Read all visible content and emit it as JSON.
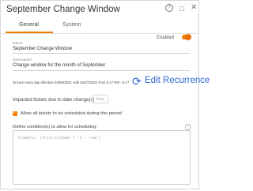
{
  "window": {
    "title": "September Change Window"
  },
  "icons": {
    "help": "question-circle-icon",
    "restore": "restore-icon",
    "close": "close-icon",
    "edit": "sync-icon"
  },
  "tabs": [
    {
      "label": "General",
      "active": true
    },
    {
      "label": "System",
      "active": false
    }
  ],
  "enabled": {
    "label": "Enabled",
    "value": true
  },
  "fields": {
    "name": {
      "label": "Name",
      "value": "September Change Window"
    },
    "description": {
      "label": "Description",
      "value": "Change window for the month of September"
    }
  },
  "recurrence": {
    "summary": "Occurs every day effective 04/09/2021 until 04/27/2021 from 5:17 PM - 6:17 PM",
    "edit_label": "Edit Recurrence"
  },
  "impacted": {
    "label": "Impacted tickets due to date change(s)",
    "view_label": "View"
  },
  "allow_all": {
    "label": "Allow all tickets to be scheduled during this period",
    "checked": true
  },
  "conditions": {
    "label": "Define condition(s) to allow for scheduling:",
    "placeholder": "Example: (PriorityName = 'X - Low')"
  },
  "colors": {
    "accent": "#f07c00",
    "link": "#2e63d1"
  }
}
